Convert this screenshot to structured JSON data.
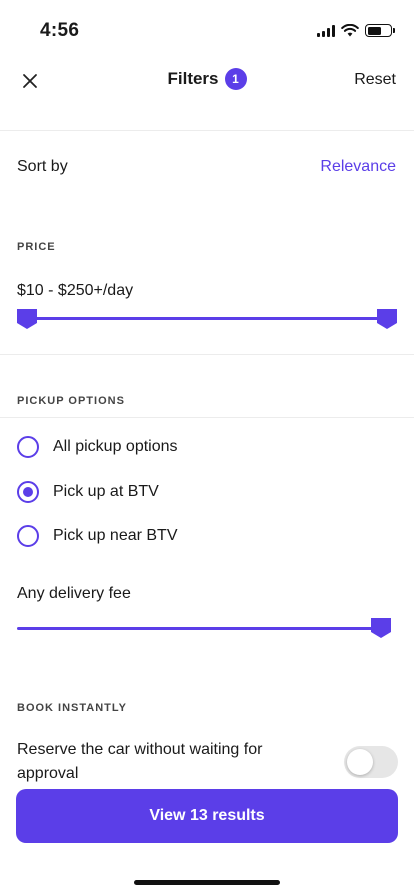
{
  "status_bar": {
    "time": "4:56"
  },
  "nav": {
    "title": "Filters",
    "badge_count": "1",
    "reset_label": "Reset"
  },
  "sort": {
    "label": "Sort by",
    "value": "Relevance"
  },
  "price": {
    "section_title": "PRICE",
    "range_text": "$10 - $250+/day",
    "min_position": 0,
    "max_position": 1
  },
  "pickup": {
    "section_title": "PICKUP OPTIONS",
    "options": [
      {
        "label": "All pickup options",
        "selected": false
      },
      {
        "label": "Pick up at BTV",
        "selected": true
      },
      {
        "label": "Pick up near BTV",
        "selected": false
      }
    ],
    "delivery_label": "Any delivery fee",
    "delivery_fee_position": 1
  },
  "book_instantly": {
    "section_title": "BOOK INSTANTLY",
    "description": "Reserve the car without waiting for approval",
    "enabled": false
  },
  "footer": {
    "view_results_label": "View 13 results"
  },
  "colors": {
    "accent": "#5b3ee8",
    "text": "#1a1a1a",
    "divider": "#ececec",
    "toggle_off": "#e6e6e6"
  }
}
